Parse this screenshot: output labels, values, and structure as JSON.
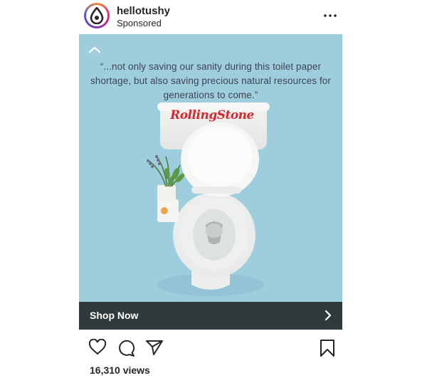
{
  "post": {
    "username": "hellotushy",
    "sponsored_label": "Sponsored",
    "more_icon": "more-options-icon",
    "avatar_colors": [
      "#f58529",
      "#dd2a7b",
      "#8134af",
      "#515bd4"
    ]
  },
  "media": {
    "quote": "“...not only saving our sanity during this toilet paper shortage, but also saving precious natural resources for generations to come.”",
    "brand_logo_text": "RollingStone",
    "background_color": "#9ecdde",
    "collapse_icon": "chevron-up-icon"
  },
  "cta": {
    "label": "Shop Now",
    "icon": "chevron-right-icon",
    "background_color": "#2f3b3a"
  },
  "actions": {
    "like_icon": "heart-icon",
    "comment_icon": "comment-icon",
    "share_icon": "paper-plane-icon",
    "save_icon": "bookmark-icon"
  },
  "stats": {
    "views": "16,310 views"
  }
}
